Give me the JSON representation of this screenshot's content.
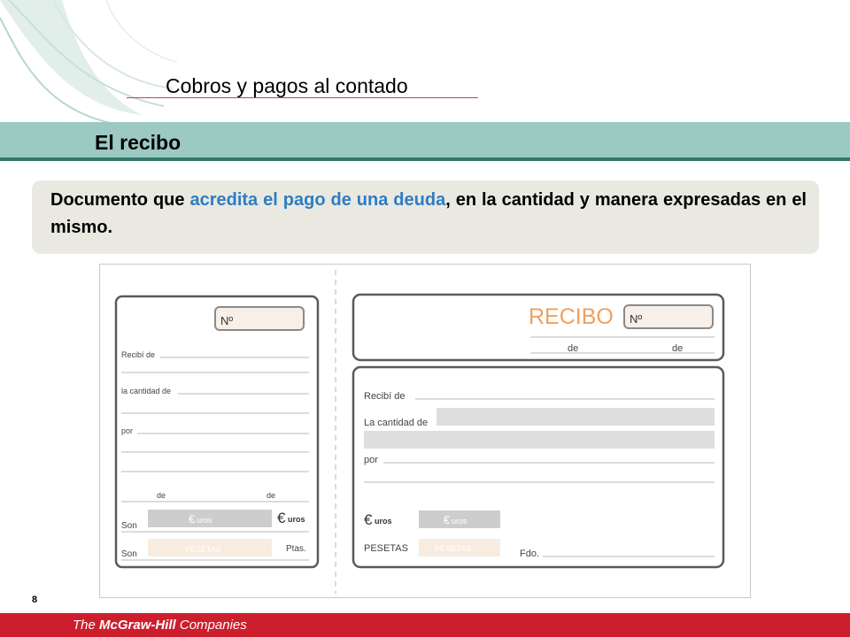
{
  "slide": {
    "title": "Cobros y pagos al contado",
    "section": "El recibo",
    "definition": {
      "part1": "Documento que ",
      "highlight": "acredita el pago de una deuda",
      "part2": ", en la cantidad y manera expresadas en el mismo."
    },
    "page_number": "8"
  },
  "footer": {
    "the": "The ",
    "brand": "McGraw-Hill",
    "companies": " Companies"
  },
  "receipt": {
    "stub": {
      "numero": "Nº",
      "recibi_de": "Recibí de",
      "cantidad_de": "la cantidad de",
      "por": "por",
      "de1": "de",
      "de2": "de",
      "son1": "Son",
      "euros_box": "uros",
      "euros_label": "uros",
      "son2": "Son",
      "pesetas_box": "PESETAS",
      "ptas": "Ptas."
    },
    "main": {
      "recibo": "RECIBO",
      "numero": "Nº",
      "de1": "de",
      "de2": "de",
      "recibi_de": "Recibí de",
      "cantidad_de": "La cantidad de",
      "por": "por",
      "euros_label": "uros",
      "euros_box": "uros",
      "pesetas": "PESETAS",
      "pesetas_box": "PESETAS",
      "fdo": "Fdo."
    }
  },
  "colors": {
    "section_bar": "#9cc9c2",
    "section_rule": "#2f7a6b",
    "highlight": "#2f7dc0",
    "recibo": "#f0a060",
    "footer": "#cc1e2c"
  }
}
